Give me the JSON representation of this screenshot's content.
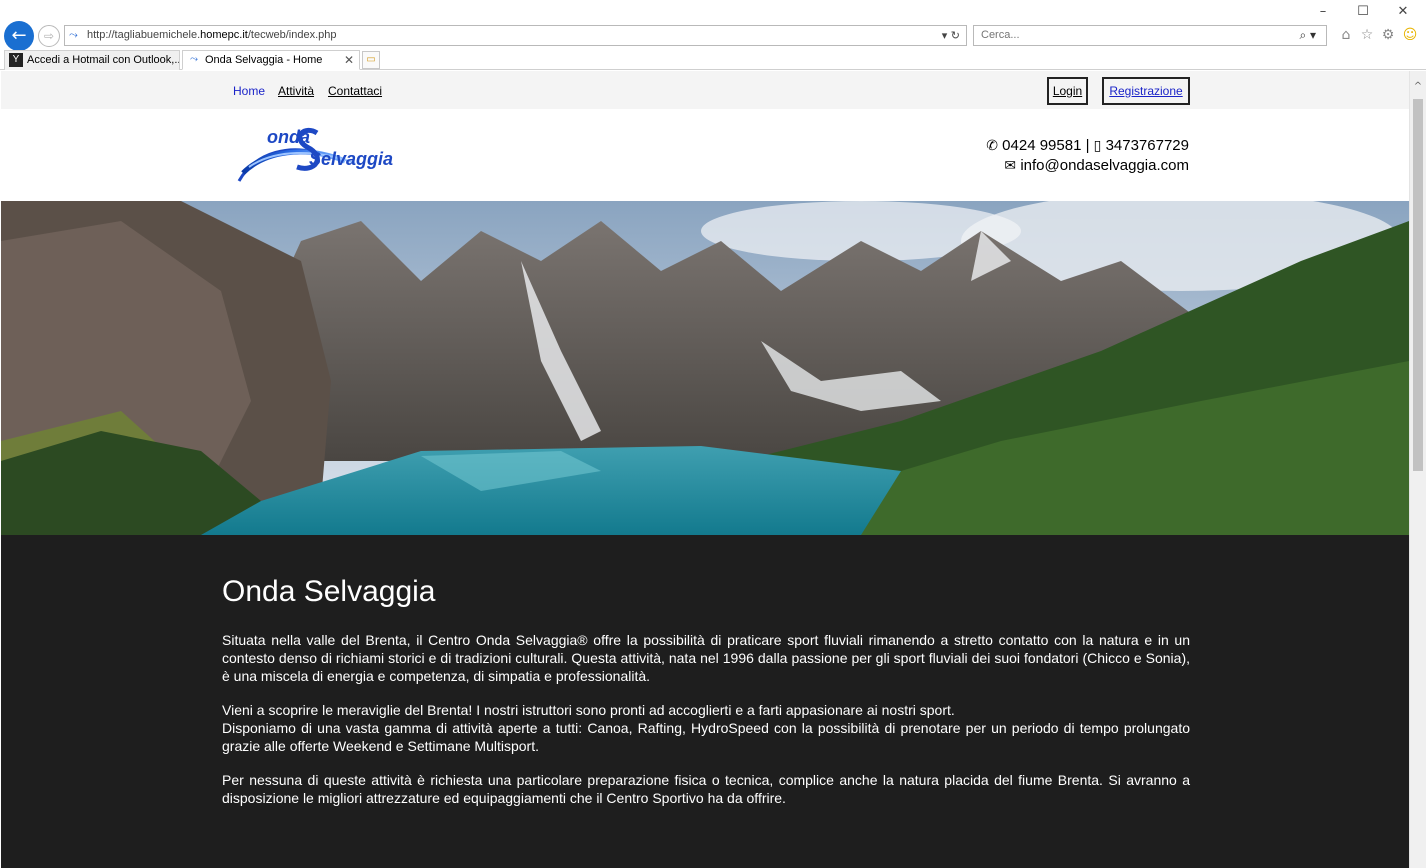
{
  "browser": {
    "address_url_prefix": "http://tagliabuemichele.",
    "address_url_domain": "homepc.it",
    "address_url_path": "/tecweb/index.php",
    "search_placeholder": "Cerca...",
    "tabs": [
      {
        "label": "Accedi a Hotmail con Outlook,..."
      },
      {
        "label": "Onda Selvaggia - Home"
      }
    ]
  },
  "nav": {
    "home": "Home",
    "attivita": "Attività",
    "contattaci": "Contattaci",
    "login": "Login",
    "registrazione": "Registrazione"
  },
  "header": {
    "logo_text_top": "onda",
    "logo_text_bottom": "Selvaggia",
    "phone": "0424 99581",
    "separator": "|",
    "mobile": "3473767729",
    "email": "info@ondaselvaggia.com"
  },
  "content": {
    "title": "Onda Selvaggia",
    "p1": "Situata nella valle del Brenta, il Centro Onda Selvaggia® offre la possibilità di praticare sport fluviali rimanendo a stretto contatto con la natura e in un contesto denso di richiami storici e di tradizioni culturali. Questa attività, nata nel 1996 dalla passione per gli sport fluviali dei suoi fondatori (Chicco e Sonia), è una miscela di energia e competenza, di simpatia e professionalità.",
    "p2_line1": "Vieni a scoprire le meraviglie del Brenta! I nostri istruttori sono pronti ad accoglierti e a farti appasionare ai nostri sport.",
    "p2_line2": "Disponiamo di una vasta gamma di attività aperte a tutti: Canoa, Rafting, HydroSpeed con la possibilità di prenotare per un periodo di tempo prolungato grazie alle offerte Weekend e Settimane Multisport.",
    "p3": "Per nessuna di queste attività è richiesta una particolare preparazione fisica o tecnica, complice anche la natura placida del fiume Brenta. Si avranno a disposizione le migliori attrezzature ed equipaggiamenti che il Centro Sportivo ha da offrire."
  },
  "colors": {
    "accent_link": "#1a23c8",
    "content_bg": "#1e1e1e",
    "topbar_bg": "#f4f4f4"
  },
  "icons": [
    "back-arrow-icon",
    "forward-arrow-icon",
    "refresh-icon",
    "search-icon",
    "home-icon",
    "favorites-star-icon",
    "gear-icon",
    "smiley-icon",
    "phone-icon",
    "mobile-icon",
    "envelope-icon"
  ]
}
